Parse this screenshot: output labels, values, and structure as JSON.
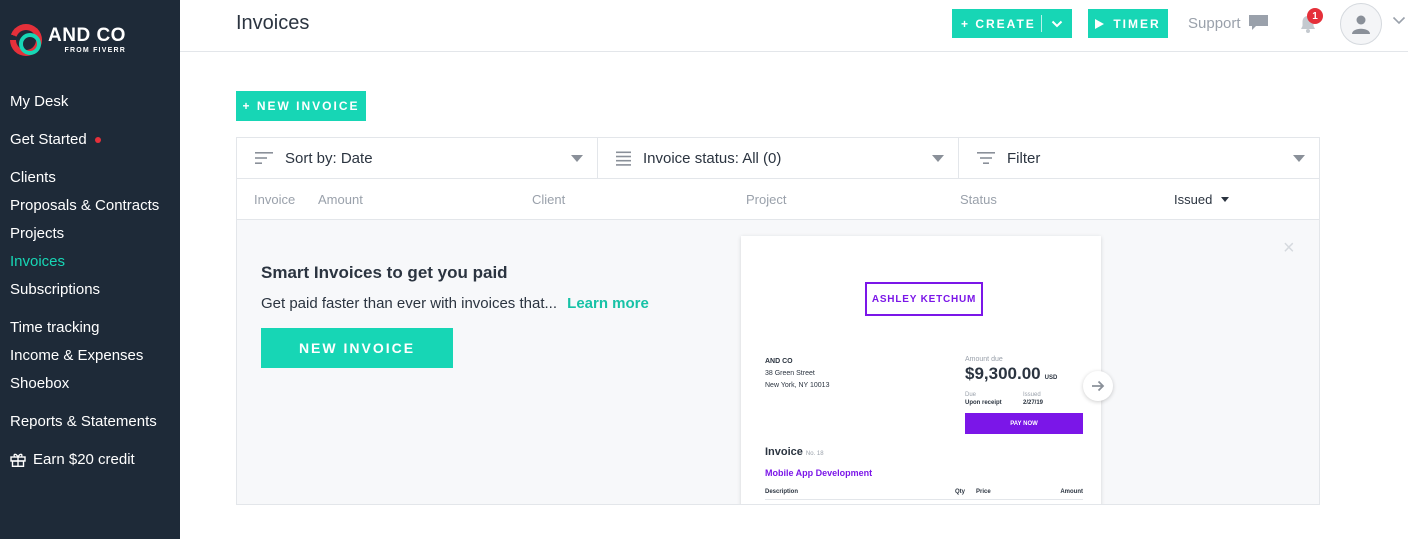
{
  "brand": {
    "name": "AND CO",
    "sub": "FROM FIVERR"
  },
  "sidebar": {
    "items": [
      {
        "label": "My Desk"
      },
      {
        "label": "Get Started"
      },
      {
        "label": "Clients"
      },
      {
        "label": "Proposals & Contracts"
      },
      {
        "label": "Projects"
      },
      {
        "label": "Invoices"
      },
      {
        "label": "Subscriptions"
      },
      {
        "label": "Time tracking"
      },
      {
        "label": "Income & Expenses"
      },
      {
        "label": "Shoebox"
      },
      {
        "label": "Reports & Statements"
      },
      {
        "label": "Earn $20 credit"
      }
    ],
    "active": "Invoices"
  },
  "header": {
    "title": "Invoices",
    "create_label": "+ CREATE",
    "timer_label": "TIMER",
    "support_label": "Support",
    "notification_count": "1"
  },
  "main": {
    "new_invoice_label": "+ NEW INVOICE",
    "toolbar": {
      "sort_label": "Sort by: Date",
      "status_label": "Invoice status: All (0)",
      "filter_label": "Filter"
    },
    "columns": [
      "Invoice",
      "Amount",
      "Client",
      "Project",
      "Status",
      "Issued"
    ],
    "promo": {
      "title": "Smart Invoices to get you paid",
      "text": "Get paid faster than ever with invoices that...",
      "link": "Learn more",
      "button": "NEW INVOICE",
      "close": "×"
    },
    "preview": {
      "brand": "ASHLEY KETCHUM",
      "from_name": "AND CO",
      "from_street": "38 Green Street",
      "from_city": "New York, NY 10013",
      "amount_label": "Amount due",
      "amount": "$9,300.00",
      "currency": "USD",
      "due_label": "Due",
      "due_value": "Upon receipt",
      "issued_label": "Issued",
      "issued_value": "2/27/19",
      "pay_label": "PAY NOW",
      "invoice_label": "Invoice",
      "invoice_no": "No. 18",
      "project": "Mobile App Development",
      "col_description": "Description",
      "col_qty": "Qty",
      "col_price": "Price",
      "col_amount": "Amount"
    }
  },
  "colors": {
    "accent": "#17d6b5",
    "sidebar_bg": "#1e2a38",
    "alert": "#e5303a",
    "preview_brand": "#7b16e8"
  }
}
